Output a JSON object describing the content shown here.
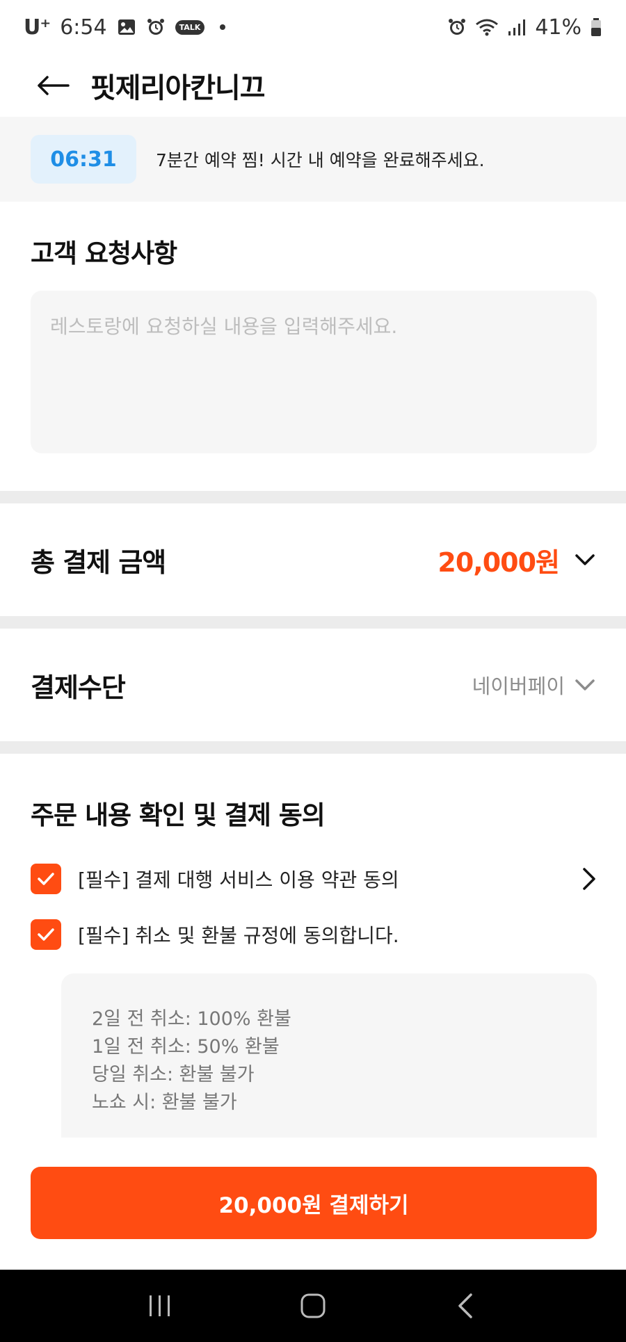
{
  "status_bar": {
    "carrier": "U⁺",
    "time": "6:54",
    "battery": "41%"
  },
  "header": {
    "title": "핏제리아칸니끄"
  },
  "timer": {
    "countdown": "06:31",
    "message": "7분간 예약 찜! 시간 내 예약을 완료해주세요."
  },
  "customer_request": {
    "title": "고객 요청사항",
    "placeholder": "레스토랑에 요청하실 내용을 입력해주세요."
  },
  "total_payment": {
    "label": "총 결제 금액",
    "amount": "20,000원"
  },
  "payment_method": {
    "label": "결제수단",
    "value": "네이버페이"
  },
  "agreement": {
    "title": "주문 내용 확인 및 결제 동의",
    "items": [
      {
        "label": "[필수] 결제 대행 서비스 이용 약관 동의",
        "checked": true
      },
      {
        "label": "[필수] 취소 및 환불 규정에 동의합니다.",
        "checked": true
      }
    ],
    "refund_policy": [
      "2일 전 취소: 100% 환불",
      "1일 전 취소: 50% 환불",
      "당일 취소: 환불 불가",
      "노쇼 시: 환불 불가"
    ]
  },
  "pay_button": {
    "label": "20,000원 결제하기"
  },
  "colors": {
    "accent": "#ff4c12",
    "timer_blue": "#1f8ee6",
    "timer_bg": "#e3f1fc"
  }
}
